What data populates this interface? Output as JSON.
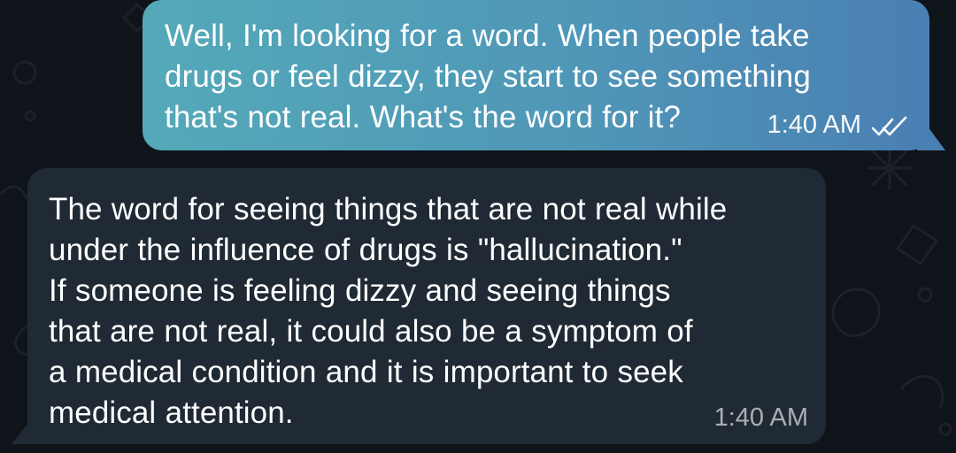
{
  "chat": {
    "messages": [
      {
        "direction": "outgoing",
        "text": "Well, I'm looking for a word. When people take\ndrugs or feel dizzy, they start to see something\nthat's not real. What's the word for it?",
        "time": "1:40 AM",
        "status_icon": "double-check-icon"
      },
      {
        "direction": "incoming",
        "text": "The word for seeing things that are not real while\nunder the influence of drugs is \"hallucination.\"\nIf someone is feeling dizzy and seeing things\nthat are not real, it could also be a symptom of\na medical condition and it is important to seek\nmedical attention.",
        "time": "1:40 AM"
      }
    ]
  },
  "colors": {
    "background": "#0f141a",
    "outgoing_bubble_start": "#54a9b8",
    "outgoing_bubble_end": "#4a7fb3",
    "incoming_bubble": "#202a34",
    "text": "#ffffff"
  }
}
